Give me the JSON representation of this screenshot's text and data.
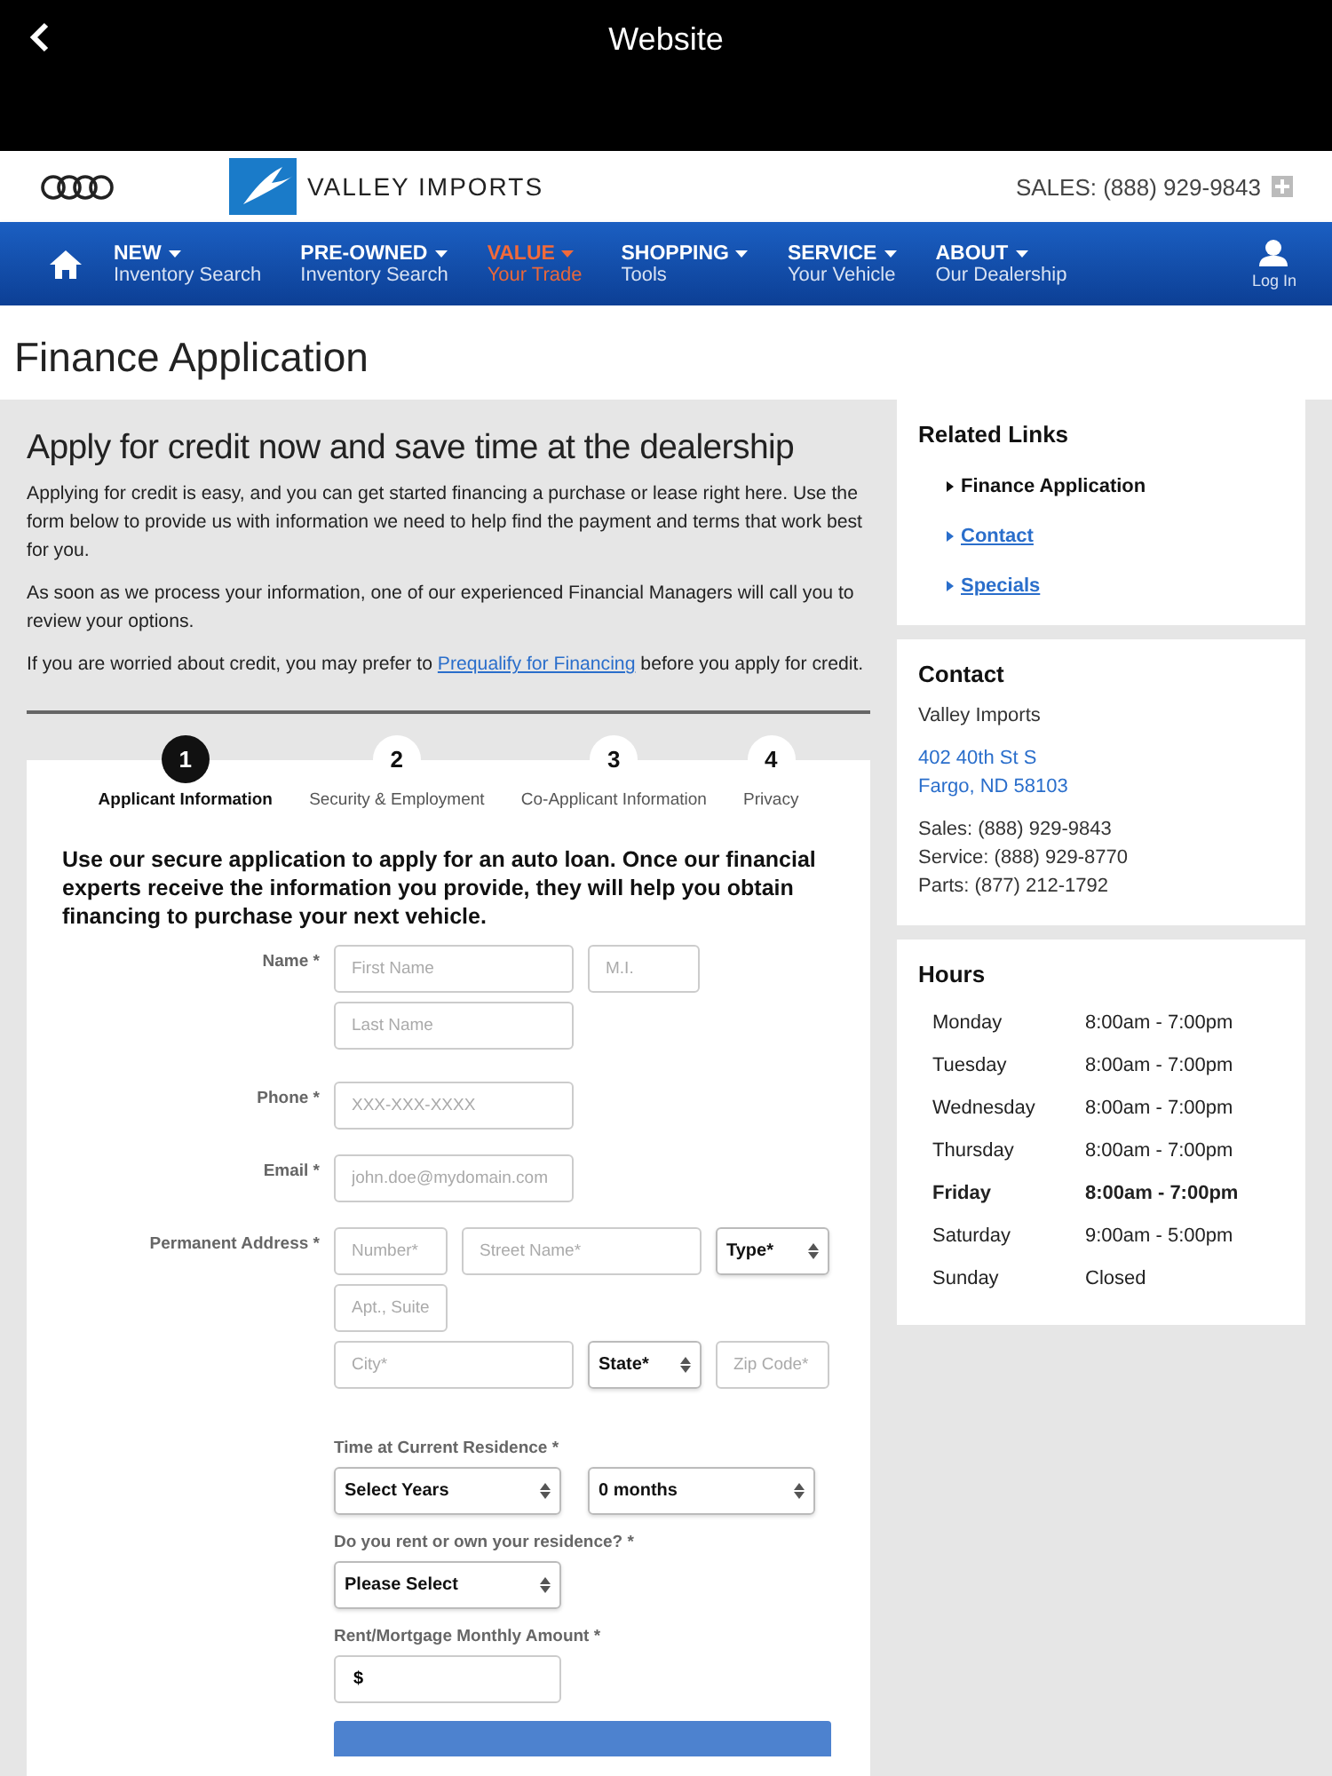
{
  "top_bar": {
    "title": "Website"
  },
  "header": {
    "brand": "VALLEY IMPORTS",
    "sales": "SALES: (888) 929-9843"
  },
  "nav": {
    "items": [
      {
        "title": "NEW",
        "subtitle": "Inventory Search",
        "selected": false
      },
      {
        "title": "PRE-OWNED",
        "subtitle": "Inventory Search",
        "selected": false
      },
      {
        "title": "VALUE",
        "subtitle": "Your Trade",
        "selected": true
      },
      {
        "title": "SHOPPING",
        "subtitle": "Tools",
        "selected": false
      },
      {
        "title": "SERVICE",
        "subtitle": "Your Vehicle",
        "selected": false
      },
      {
        "title": "ABOUT",
        "subtitle": "Our Dealership",
        "selected": false
      }
    ],
    "login": "Log In"
  },
  "page_title": "Finance Application",
  "main": {
    "heading": "Apply for credit now and save time at the dealership",
    "paragraphs": [
      "Applying for credit is easy, and you can get started financing a purchase or lease right here. Use the form below to provide us with information we need to help find the payment and terms that work best for you.",
      "As soon as we process your information, one of our experienced Financial Managers will call you to review your options."
    ],
    "prequalify": {
      "before": "If you are worried about credit, you may prefer to",
      "link": "Prequalify for Financing",
      "after": "before you apply for credit."
    },
    "steps": [
      {
        "number": "1",
        "label": "Applicant Information",
        "selected": true
      },
      {
        "number": "2",
        "label": "Security & Employment",
        "selected": false
      },
      {
        "number": "3",
        "label": "Co-Applicant Information",
        "selected": false
      },
      {
        "number": "4",
        "label": "Privacy",
        "selected": false
      }
    ],
    "form": {
      "intro": "Use our secure application to apply for an auto loan. Once our financial experts receive the information you provide, they will help you obtain financing to purchase your next vehicle.",
      "name": {
        "label": "Name *",
        "first": {
          "placeholder": "First Name"
        },
        "middle": {
          "placeholder": "M.I."
        },
        "last": {
          "placeholder": "Last Name"
        }
      },
      "phone": {
        "label": "Phone *",
        "placeholder": "XXX-XXX-XXXX"
      },
      "email": {
        "label": "Email *",
        "placeholder": "john.doe@mydomain.com"
      },
      "address": {
        "label": "Permanent Address *",
        "number": {
          "placeholder": "Number*"
        },
        "street": {
          "placeholder": "Street Name*"
        },
        "type": "Type*",
        "apt": {
          "placeholder": "Apt., Suite"
        },
        "city": {
          "placeholder": "City*"
        },
        "state": "State*",
        "zip": {
          "placeholder": "Zip Code*"
        }
      },
      "residence_time": {
        "label": "Time at Current Residence *",
        "years": "Select Years",
        "months": "0 months"
      },
      "rent_own": {
        "label": "Do you rent or own your residence? *",
        "value": "Please Select"
      },
      "monthly_amount": {
        "label": "Rent/Mortgage Monthly Amount *",
        "value": "$"
      }
    }
  },
  "sidebar": {
    "related": {
      "title": "Related Links",
      "links": [
        {
          "label": "Finance Application",
          "current": true
        },
        {
          "label": "Contact",
          "current": false
        },
        {
          "label": "Specials",
          "current": false
        }
      ]
    },
    "contact": {
      "title": "Contact",
      "name": "Valley Imports",
      "address": [
        "402 40th St S",
        "Fargo, ND 58103"
      ],
      "phones": [
        "Sales: (888) 929-9843",
        "Service: (888) 929-8770",
        "Parts: (877) 212-1792"
      ]
    },
    "hours": {
      "title": "Hours",
      "days": [
        {
          "day": "Monday",
          "time": "8:00am - 7:00pm",
          "today": false
        },
        {
          "day": "Tuesday",
          "time": "8:00am - 7:00pm",
          "today": false
        },
        {
          "day": "Wednesday",
          "time": "8:00am - 7:00pm",
          "today": false
        },
        {
          "day": "Thursday",
          "time": "8:00am - 7:00pm",
          "today": false
        },
        {
          "day": "Friday",
          "time": "8:00am - 7:00pm",
          "today": true
        },
        {
          "day": "Saturday",
          "time": "9:00am - 5:00pm",
          "today": false
        },
        {
          "day": "Sunday",
          "time": "Closed",
          "today": false
        }
      ]
    }
  }
}
